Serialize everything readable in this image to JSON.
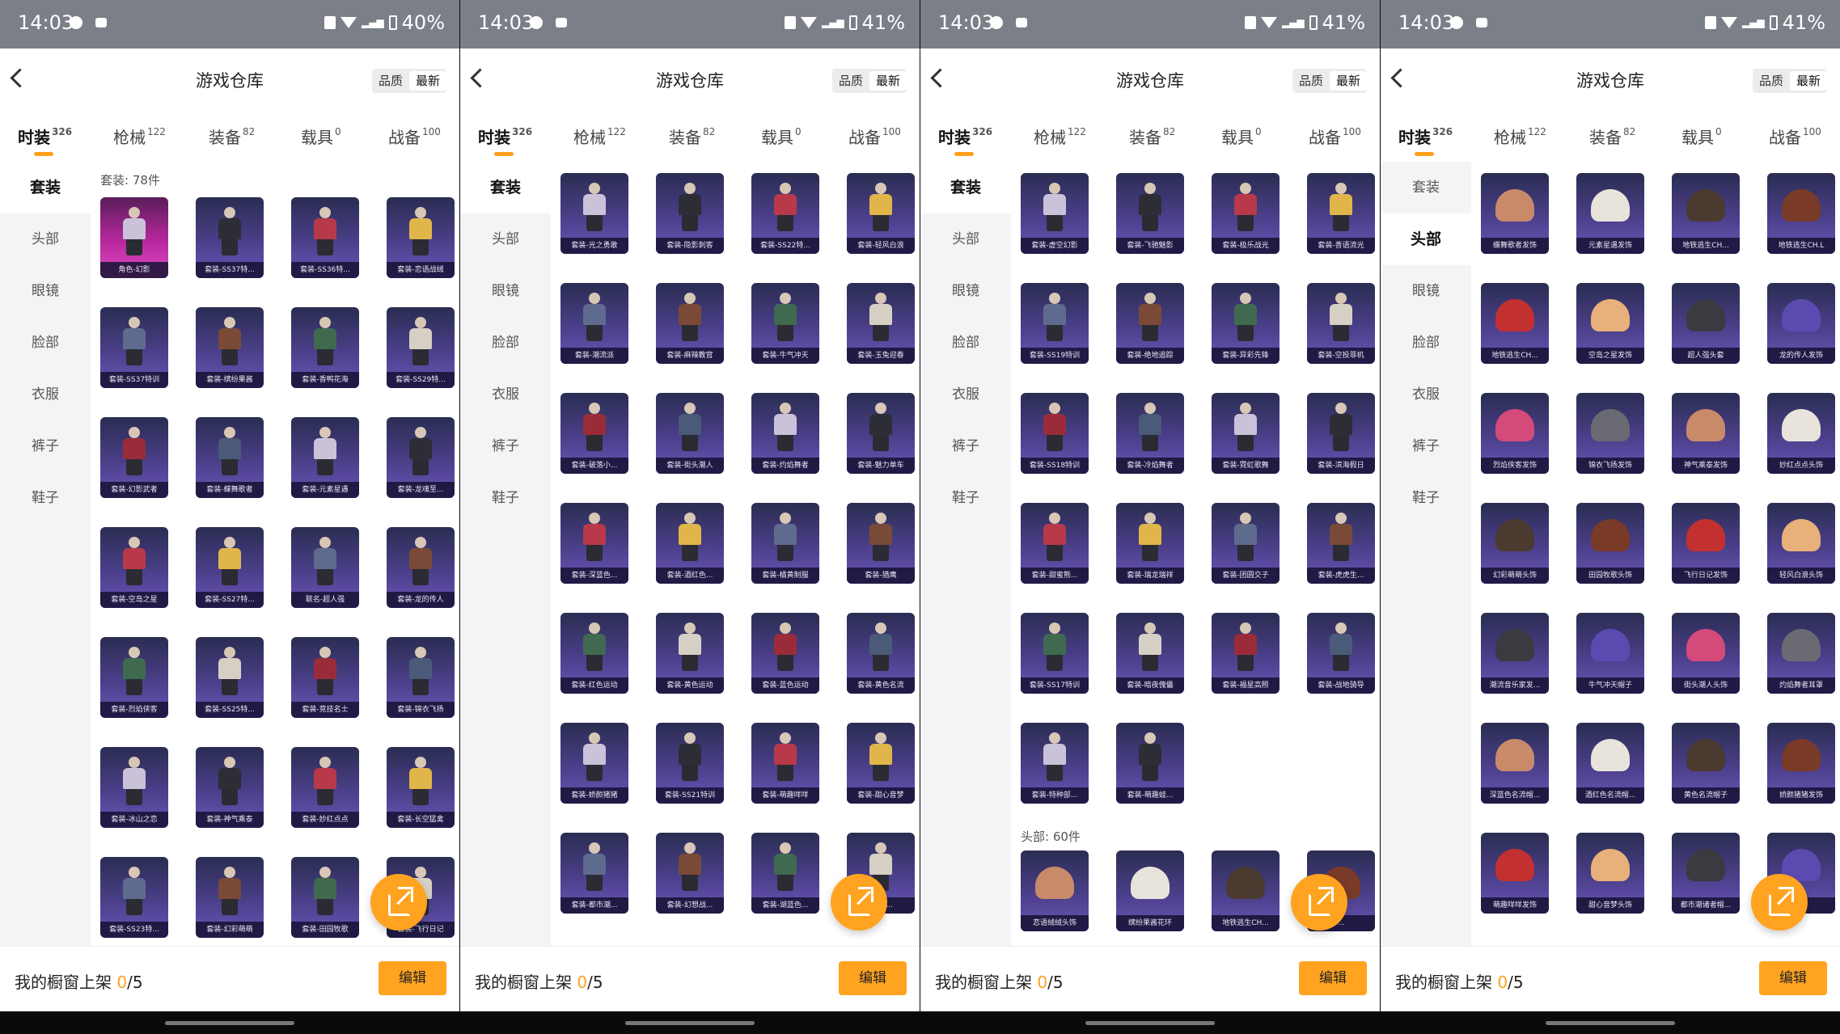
{
  "panels": [
    {
      "status": {
        "time": "14:03",
        "battery": "40%"
      },
      "title": "游戏仓库",
      "sort": [
        "品质",
        "最新"
      ],
      "sort_active": 1,
      "tabs": [
        {
          "label": "时装",
          "count": "326"
        },
        {
          "label": "枪械",
          "count": "122"
        },
        {
          "label": "装备",
          "count": "82"
        },
        {
          "label": "载具",
          "count": "0"
        },
        {
          "label": "战备",
          "count": "100"
        }
      ],
      "active_tab": 0,
      "sidebar": [
        "套装",
        "头部",
        "眼镜",
        "脸部",
        "衣服",
        "裤子",
        "鞋子"
      ],
      "active_side": 0,
      "section_label": "套装: 78件",
      "section_label2": "",
      "items": [
        "角色-幻影",
        "套装-SS37特...",
        "套装-SS36特...",
        "套装-恋语战绒",
        "套装-SS37特训",
        "套装-缤纷果酱",
        "套装-香鸭花海",
        "套装-SS29特...",
        "套装-幻影武者",
        "套装-蝶舞歌者",
        "套装-元素星遇",
        "套装-龙魂至...",
        "套装-空岛之星",
        "套装-SS27特...",
        "联名-超人强",
        "套装-龙的传人",
        "套装-烈焰侠客",
        "套装-SS25特...",
        "套装-竞技名士",
        "套装-锦衣飞扬",
        "套装-冰山之恋",
        "套装-神气乘泰",
        "套装-妙红点点",
        "套装-长空猛禽",
        "套装-SS23特...",
        "套装-幻彩萌萌",
        "套装-田园牧歌",
        "套装-飞行日记"
      ],
      "items2": [],
      "legend_idx": [
        0
      ],
      "hat_mode": false,
      "showcase_prefix": "我的橱窗上架 ",
      "showcase_count": "0",
      "showcase_total": "/5",
      "edit": "编辑"
    },
    {
      "status": {
        "time": "14:03",
        "battery": "41%"
      },
      "title": "游戏仓库",
      "sort": [
        "品质",
        "最新"
      ],
      "sort_active": 1,
      "tabs": [
        {
          "label": "时装",
          "count": "326"
        },
        {
          "label": "枪械",
          "count": "122"
        },
        {
          "label": "装备",
          "count": "82"
        },
        {
          "label": "载具",
          "count": "0"
        },
        {
          "label": "战备",
          "count": "100"
        }
      ],
      "active_tab": 0,
      "sidebar": [
        "套装",
        "头部",
        "眼镜",
        "脸部",
        "衣服",
        "裤子",
        "鞋子"
      ],
      "active_side": 0,
      "section_label": "",
      "section_label2": "",
      "items": [
        "套装-光之勇敢",
        "套装-隐影刺客",
        "套装-SS22特...",
        "套装-轻风白浪",
        "套装-潮流派",
        "套装-麻辣教官",
        "套装-牛气冲天",
        "套装-玉兔迎春",
        "套装-破落小...",
        "套装-街头潮人",
        "套装-灼焰舞者",
        "套装-魅力单车",
        "套装-深蓝色...",
        "套装-酒红色...",
        "套装-橘黄制服",
        "套装-猎鹰",
        "套装-红色运动",
        "套装-黄色运动",
        "套装-蓝色运动",
        "套装-黄色名流",
        "套装-娇颜猪猪",
        "套装-SS21特训",
        "套装-萌趣咩咩",
        "套装-甜心音梦",
        "套装-都市潮...",
        "套装-幻想战...",
        "套装-湖蓝色...",
        "套装-..."
      ],
      "items2": [],
      "legend_idx": [],
      "hat_mode": false,
      "showcase_prefix": "我的橱窗上架 ",
      "showcase_count": "0",
      "showcase_total": "/5",
      "edit": "编辑"
    },
    {
      "status": {
        "time": "14:03",
        "battery": "41%"
      },
      "title": "游戏仓库",
      "sort": [
        "品质",
        "最新"
      ],
      "sort_active": 1,
      "tabs": [
        {
          "label": "时装",
          "count": "326"
        },
        {
          "label": "枪械",
          "count": "122"
        },
        {
          "label": "装备",
          "count": "82"
        },
        {
          "label": "载具",
          "count": "0"
        },
        {
          "label": "战备",
          "count": "100"
        }
      ],
      "active_tab": 0,
      "sidebar": [
        "套装",
        "头部",
        "眼镜",
        "脸部",
        "衣服",
        "裤子",
        "鞋子"
      ],
      "active_side": 0,
      "section_label": "",
      "section_label2": "头部: 60件",
      "items": [
        "套装-虚空幻影",
        "套装-飞驰魅影",
        "套装-极乐战光",
        "套装-善语流光",
        "套装-SS19特训",
        "套装-绝地追踪",
        "套装-异彩先锋",
        "套装-空投菲机",
        "套装-SS18特训",
        "套装-冷焰舞者",
        "套装-霓虹歌舞",
        "套装-滨海假日",
        "套装-甜蜜熊...",
        "套装-瑞龙瑞祥",
        "套装-团圆交子",
        "套装-虎虎生...",
        "套装-SS17特训",
        "套装-暗夜傀儡",
        "套装-福星高照",
        "套装-战地骑导",
        "套装-特种部...",
        "套装-萌趣蛙..."
      ],
      "items2": [
        "恋语绒绒头饰",
        "缤纷果酱花环",
        "地铁逃生CH...",
        "..."
      ],
      "legend_idx": [],
      "hat_mode": false,
      "showcase_prefix": "我的橱窗上架 ",
      "showcase_count": "0",
      "showcase_total": "/5",
      "edit": "编辑"
    },
    {
      "status": {
        "time": "14:03",
        "battery": "41%"
      },
      "title": "游戏仓库",
      "sort": [
        "品质",
        "最新"
      ],
      "sort_active": 1,
      "tabs": [
        {
          "label": "时装",
          "count": "326"
        },
        {
          "label": "枪械",
          "count": "122"
        },
        {
          "label": "装备",
          "count": "82"
        },
        {
          "label": "载具",
          "count": "0"
        },
        {
          "label": "战备",
          "count": "100"
        }
      ],
      "active_tab": 0,
      "sidebar": [
        "套装",
        "头部",
        "眼镜",
        "脸部",
        "衣服",
        "裤子",
        "鞋子"
      ],
      "active_side": 1,
      "section_label": "",
      "section_label2": "",
      "items": [
        "蝶舞歌者发饰",
        "元素星遇发饰",
        "地铁逃生CH...",
        "地铁逃生CH.L",
        "地铁逃生CH...",
        "空岛之星发饰",
        "超人强头套",
        "龙的传人发饰",
        "烈焰侠客发饰",
        "锦衣飞扬发饰",
        "神气乘泰发饰",
        "妙红点点头饰",
        "幻彩萌萌头饰",
        "田园牧歌头饰",
        "飞行日记发饰",
        "轻风白浪头饰",
        "潮流音乐家发...",
        "牛气冲天帽子",
        "街头潮人头饰",
        "灼焰舞者耳罩",
        "深蓝色名流帽...",
        "酒红色名流帽...",
        "黄色名流帽子",
        "娇颜猪猪发饰",
        "萌趣咩咩发饰",
        "甜心音梦头饰",
        "都市潮诸者帽...",
        "..."
      ],
      "items2": [],
      "legend_idx": [],
      "hat_mode": true,
      "showcase_prefix": "我的橱窗上架 ",
      "showcase_count": "0",
      "showcase_total": "/5",
      "edit": "编辑"
    }
  ],
  "colors": {
    "accent": "#ffa320",
    "card_epic": "#4b3f8a",
    "card_legend": "#b8289e"
  }
}
